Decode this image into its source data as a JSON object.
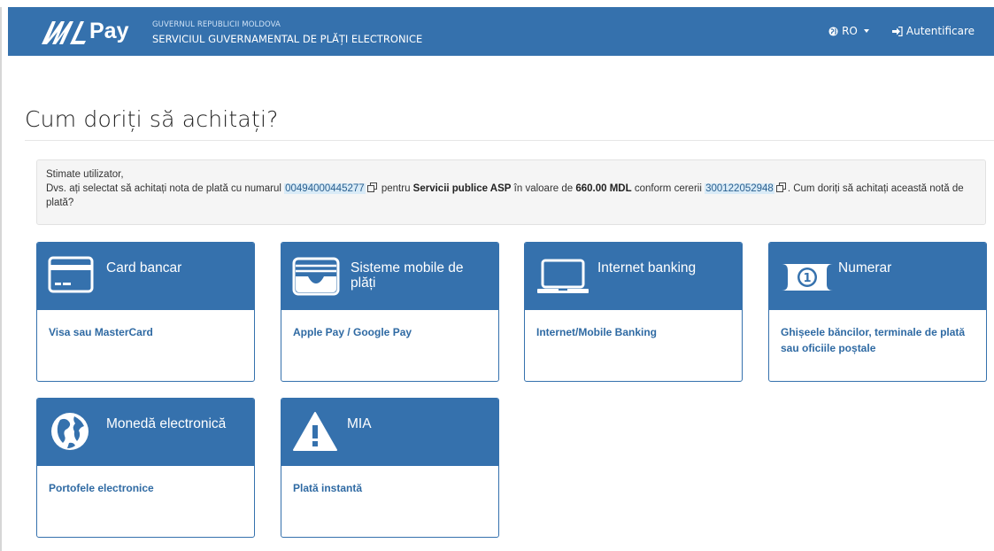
{
  "header": {
    "logo_text": "Pay",
    "gov_label": "GUVERNUL REPUBLICII MOLDOVA",
    "service_title": "SERVICIUL GUVERNAMENTAL DE PLĂȚI ELECTRONICE",
    "language": "RO",
    "login_label": "Autentificare"
  },
  "main": {
    "title": "Cum doriți să achitați?",
    "info": {
      "greeting": "Stimate utilizator,",
      "text_1": "Dvs. ați selectat să achitați nota de plată cu numarul ",
      "invoice_number": "00494000445277",
      "text_2": " pentru ",
      "service_name": "Servicii publice ASP",
      "text_3": " în valoare de ",
      "amount": "660.00 MDL",
      "text_4": " conform cererii ",
      "request_number": "300122052948",
      "text_5": ". Cum doriți să achitați această notă de plată?"
    },
    "methods": [
      {
        "title": "Card bancar",
        "description": "Visa sau MasterCard",
        "icon": "credit-card-icon"
      },
      {
        "title": "Sisteme mobile de plăți",
        "description": "Apple Pay / Google Pay",
        "icon": "wallet-icon"
      },
      {
        "title": "Internet banking",
        "description": "Internet/Mobile Banking",
        "icon": "laptop-icon"
      },
      {
        "title": "Numerar",
        "description": "Ghișeele băncilor, terminale de plată sau oficiile poștale",
        "icon": "banknote-icon"
      },
      {
        "title": "Monedă electronică",
        "description": "Portofele electronice",
        "icon": "globe-icon"
      },
      {
        "title": "MIA",
        "description": "Plată instantă",
        "icon": "warning-icon"
      }
    ]
  },
  "colors": {
    "primary": "#3571ad",
    "highlight_bg": "#d9ebf7",
    "link": "#2f6aa3"
  }
}
